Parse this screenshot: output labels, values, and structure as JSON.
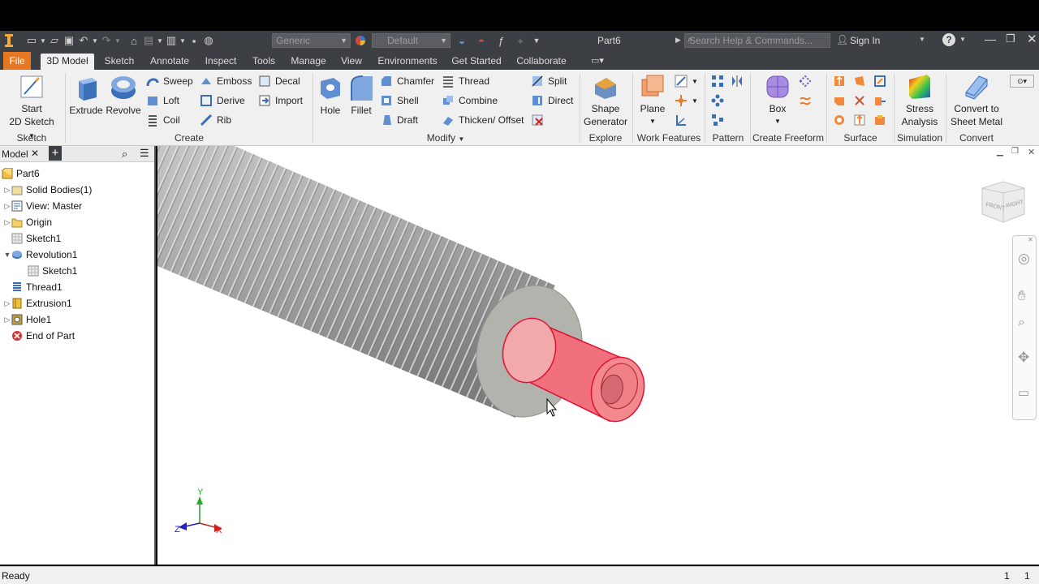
{
  "titlebar": {
    "material_combo": "Generic",
    "appearance_combo": "Default",
    "document_title": "Part6",
    "search_placeholder": "Search Help & Commands...",
    "sign_in": "Sign In"
  },
  "tabs": [
    "File",
    "3D Model",
    "Sketch",
    "Annotate",
    "Inspect",
    "Tools",
    "Manage",
    "View",
    "Environments",
    "Get Started",
    "Collaborate"
  ],
  "ribbon": {
    "sketch": {
      "start_line1": "Start",
      "start_line2": "2D Sketch",
      "panel": "Sketch"
    },
    "create": {
      "extrude": "Extrude",
      "revolve": "Revolve",
      "sweep": "Sweep",
      "loft": "Loft",
      "coil": "Coil",
      "emboss": "Emboss",
      "derive": "Derive",
      "rib": "Rib",
      "decal": "Decal",
      "import": "Import",
      "panel": "Create"
    },
    "modify": {
      "hole": "Hole",
      "fillet": "Fillet",
      "chamfer": "Chamfer",
      "shell": "Shell",
      "draft": "Draft",
      "thread": "Thread",
      "combine": "Combine",
      "thicken": "Thicken/ Offset",
      "split": "Split",
      "direct": "Direct",
      "panel": "Modify"
    },
    "explore": {
      "shape_line1": "Shape",
      "shape_line2": "Generator",
      "panel": "Explore"
    },
    "work_features": {
      "plane": "Plane",
      "panel": "Work Features"
    },
    "pattern": {
      "panel": "Pattern"
    },
    "freeform": {
      "box": "Box",
      "panel": "Create Freeform"
    },
    "surface": {
      "panel": "Surface"
    },
    "simulation": {
      "line1": "Stress",
      "line2": "Analysis",
      "panel": "Simulation"
    },
    "convert": {
      "line1": "Convert to",
      "line2": "Sheet Metal",
      "panel": "Convert"
    }
  },
  "browser": {
    "tab_label": "Model",
    "items": [
      {
        "label": "Part6",
        "icon": "part-icon"
      },
      {
        "label": "Solid Bodies(1)",
        "icon": "solid-bodies-icon"
      },
      {
        "label": "View: Master",
        "icon": "view-icon"
      },
      {
        "label": "Origin",
        "icon": "folder-icon"
      },
      {
        "label": "Sketch1",
        "icon": "sketch-icon"
      },
      {
        "label": "Revolution1",
        "icon": "revolve-icon"
      },
      {
        "label": "Sketch1",
        "icon": "sketch-icon"
      },
      {
        "label": "Thread1",
        "icon": "thread-icon"
      },
      {
        "label": "Extrusion1",
        "icon": "extrude-icon"
      },
      {
        "label": "Hole1",
        "icon": "hole-icon"
      },
      {
        "label": "End of Part",
        "icon": "end-of-part-icon"
      }
    ]
  },
  "viewcube": {
    "front": "FRONT",
    "right": "RIGHT"
  },
  "triad": {
    "y": "Y",
    "x": "X",
    "z": "Z"
  },
  "status": {
    "text": "Ready",
    "count1": "1",
    "count2": "1"
  },
  "colors": {
    "accent_file": "#e87722",
    "selection_red": "#f06070",
    "body_gray": "#a8a8a8"
  }
}
